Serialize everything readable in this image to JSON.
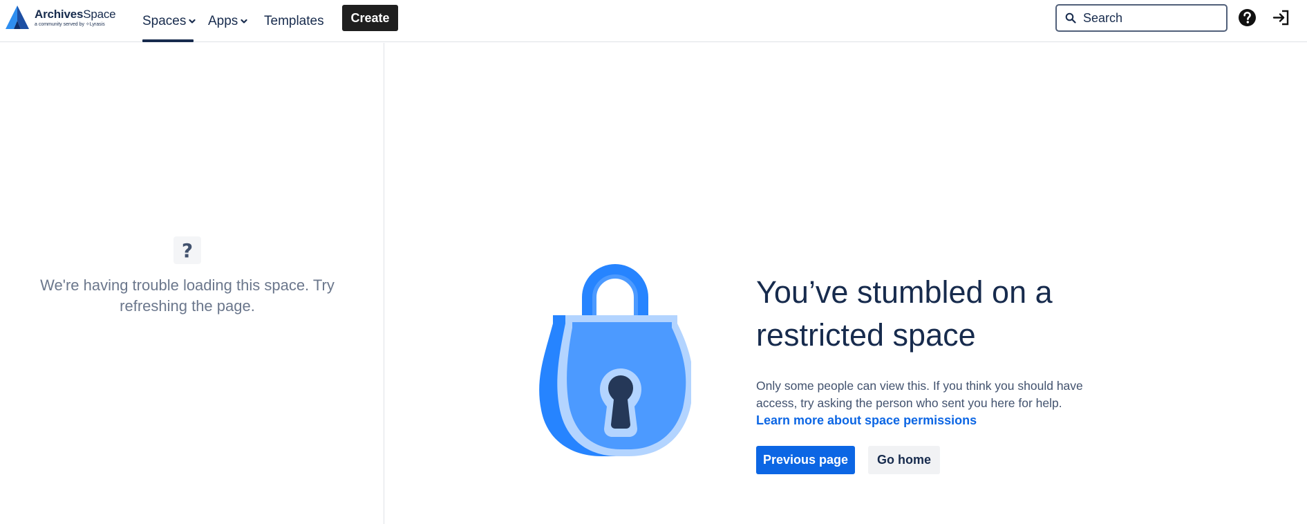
{
  "app": {
    "logo_name_bold": "Archives",
    "logo_name_light": "Space",
    "logo_tagline": "a community served by ✧Lyrasis"
  },
  "nav": {
    "spaces_label": "Spaces",
    "apps_label": "Apps",
    "templates_label": "Templates",
    "create_label": "Create",
    "active_item": "Spaces"
  },
  "search": {
    "placeholder": "Search",
    "value": ""
  },
  "icons": {
    "logo": "archivesspace-logo-icon",
    "dropdown": "chevron-down-icon",
    "search": "search-icon",
    "help": "help-icon",
    "login": "login-icon",
    "question": "question-icon",
    "lock": "padlock-illustration"
  },
  "sidebar": {
    "question_mark": "?",
    "message": "We're having trouble loading this space. Try refreshing the page."
  },
  "main": {
    "headline": "You’ve stumbled on a restricted space",
    "description": "Only some people can view this. If you think you should have access, try asking the person who sent you here for help.",
    "link": "Learn more about space permissions",
    "primary_button": "Previous page",
    "secondary_button": "Go home"
  },
  "colors": {
    "primary": "#0c66e4",
    "create_button": "#1f1f1f",
    "text": "#172b4d",
    "muted_text": "#6b778c",
    "logo_blue": "#1f6fd8",
    "lock_blue": "#4c9aff",
    "lock_dark_blue": "#2684ff",
    "lock_light_blue": "#b3d4ff"
  }
}
